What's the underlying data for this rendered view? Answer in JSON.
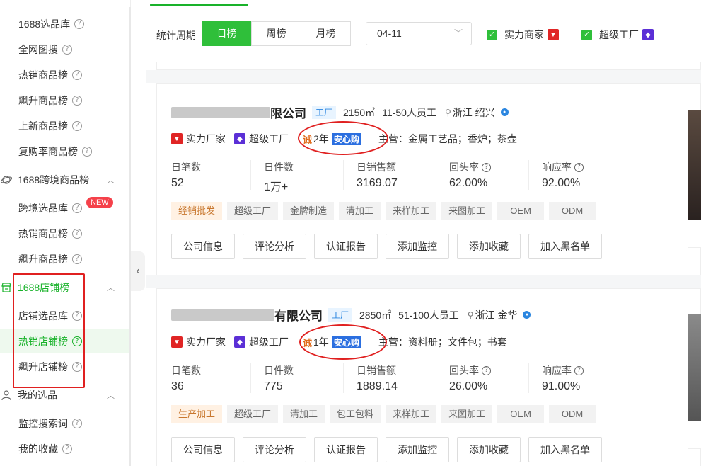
{
  "sidebar": {
    "items_top": [
      {
        "label": "1688选品库"
      },
      {
        "label": "全网图搜"
      },
      {
        "label": "热销商品榜"
      },
      {
        "label": "飙升商品榜"
      },
      {
        "label": "上新商品榜"
      },
      {
        "label": "复购率商品榜"
      }
    ],
    "group_cross": {
      "label": "1688跨境商品榜"
    },
    "items_cross": [
      {
        "label": "跨境选品库",
        "badge": "NEW"
      },
      {
        "label": "热销商品榜"
      },
      {
        "label": "飙升商品榜"
      }
    ],
    "group_shop": {
      "label": "1688店铺榜"
    },
    "items_shop": [
      {
        "label": "店铺选品库"
      },
      {
        "label": "热销店铺榜"
      },
      {
        "label": "飙升店铺榜"
      }
    ],
    "group_mine": {
      "label": "我的选品"
    },
    "items_mine": [
      {
        "label": "监控搜索词"
      },
      {
        "label": "我的收藏"
      }
    ],
    "help_glyph": "?"
  },
  "filters": {
    "period_label": "统计周期",
    "periods": [
      "日榜",
      "周榜",
      "月榜"
    ],
    "active_period": "日榜",
    "date_value": "04-11",
    "checkbox_strong": "实力商家",
    "checkbox_super": "超级工厂"
  },
  "cards": [
    {
      "name_tail": "限公司",
      "type_tag": "工厂",
      "area": "2150㎡",
      "staff": "11-50人员工",
      "location": "浙江 绍兴",
      "badge_strong": "实力厂家",
      "badge_super": "超级工厂",
      "years": "2年",
      "fangxin": "安心购",
      "main_business": "主营：金属工艺品；香炉；茶壶",
      "stats": [
        {
          "label": "日笔数",
          "value": "52"
        },
        {
          "label": "日件数",
          "value": "1万+"
        },
        {
          "label": "日销售额",
          "value": "3169.07"
        },
        {
          "label": "回头率",
          "value": "62.00%"
        },
        {
          "label": "响应率",
          "value": "92.00%"
        }
      ],
      "tags": [
        "经销批发",
        "超级工厂",
        "金牌制造",
        "清加工",
        "来样加工",
        "来图加工",
        "OEM",
        "ODM"
      ],
      "actions": [
        "公司信息",
        "评论分析",
        "认证报告",
        "添加监控",
        "添加收藏",
        "加入黑名单"
      ]
    },
    {
      "name_tail": "有限公司",
      "type_tag": "工厂",
      "area": "2850㎡",
      "staff": "51-100人员工",
      "location": "浙江 金华",
      "badge_strong": "实力厂家",
      "badge_super": "超级工厂",
      "years": "1年",
      "fangxin": "安心购",
      "main_business": "主营：资料册；文件包；书套",
      "stats": [
        {
          "label": "日笔数",
          "value": "36"
        },
        {
          "label": "日件数",
          "value": "775"
        },
        {
          "label": "日销售额",
          "value": "1889.14"
        },
        {
          "label": "回头率",
          "value": "26.00%"
        },
        {
          "label": "响应率",
          "value": "91.00%"
        }
      ],
      "tags": [
        "生产加工",
        "超级工厂",
        "清加工",
        "包工包料",
        "来样加工",
        "来图加工",
        "OEM",
        "ODM"
      ],
      "actions": [
        "公司信息",
        "评论分析",
        "认证报告",
        "添加监控",
        "添加收藏",
        "加入黑名单"
      ]
    }
  ],
  "colors": {
    "accent": "#19b22a",
    "annotation": "#e02020",
    "badge_red": "#e02525",
    "badge_purple": "#5b2fd6"
  }
}
